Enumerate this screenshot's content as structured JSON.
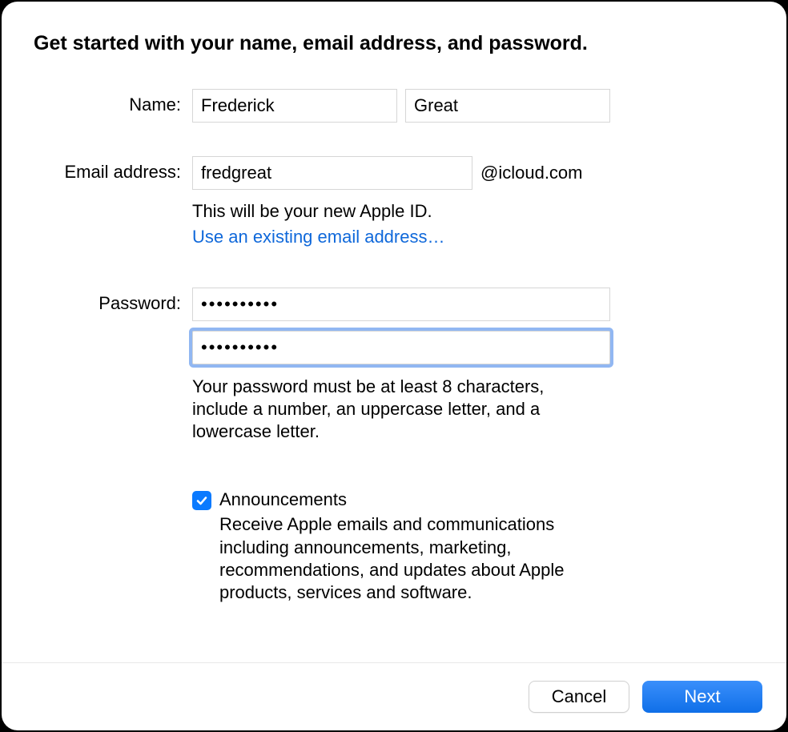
{
  "title": "Get started with your name, email address, and password.",
  "labels": {
    "name": "Name:",
    "email": "Email address:",
    "password": "Password:"
  },
  "values": {
    "first_name": "Frederick",
    "last_name": "Great",
    "email_local": "fredgreat",
    "password": "••••••••••",
    "password_confirm": "••••••••••"
  },
  "email_suffix": "@icloud.com",
  "email_hint": "This will be your new Apple ID.",
  "email_link": "Use an existing email address…",
  "password_hint": "Your password must be at least 8 characters, include a number, an uppercase letter, and a lowercase letter.",
  "checkbox": {
    "checked": true,
    "label": "Announcements",
    "description": "Receive Apple emails and communications including announcements, marketing, recommendations, and updates about Apple products, services and software."
  },
  "buttons": {
    "cancel": "Cancel",
    "next": "Next"
  }
}
